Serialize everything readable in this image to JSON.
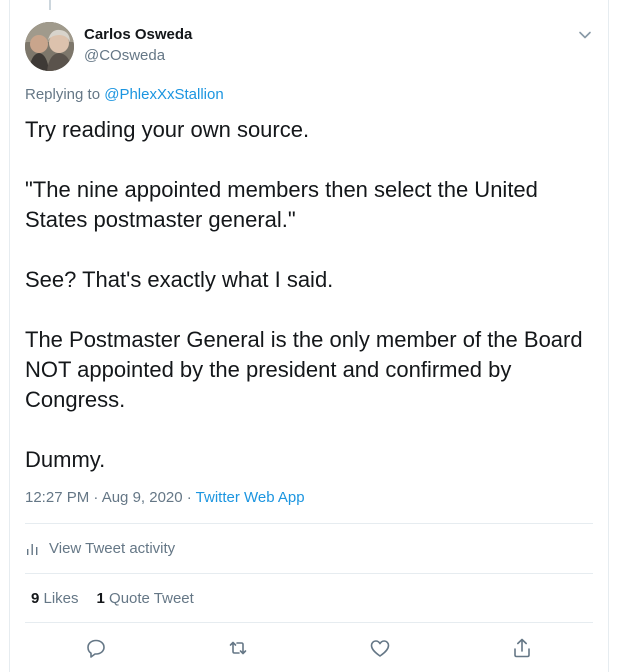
{
  "tweet": {
    "author": {
      "name": "Carlos Osweda",
      "handle": "@COsweda"
    },
    "replying_prefix": "Replying to",
    "replying_to": "@PhlexXxStallion",
    "text": "Try reading your own source.\n\n\"The nine appointed members then select the United States postmaster general.\"\n\nSee? That's exactly what I said.\n\nThe Postmaster General is the only member of the Board NOT appointed by the president and confirmed by Congress.\n\nDummy.",
    "timestamp": "12:27 PM · Aug 9, 2020 · ",
    "source": "Twitter Web App"
  },
  "activity": {
    "label": "View Tweet activity",
    "icon": "bar-chart-icon"
  },
  "stats": {
    "likes_count": "9",
    "likes_label": " Likes",
    "quotes_count": "1",
    "quotes_label": " Quote Tweet"
  },
  "actions": {
    "icons": [
      "reply-icon",
      "retweet-icon",
      "like-icon",
      "share-icon"
    ]
  },
  "colors": {
    "accent": "#1b95e0",
    "text": "#14171a",
    "muted": "#657786",
    "border": "#e6ecf0"
  }
}
